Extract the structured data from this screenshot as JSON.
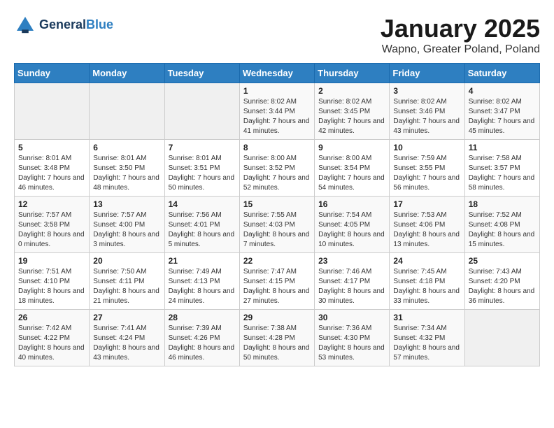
{
  "header": {
    "logo_line1": "General",
    "logo_line2": "Blue",
    "title": "January 2025",
    "subtitle": "Wapno, Greater Poland, Poland"
  },
  "days_of_week": [
    "Sunday",
    "Monday",
    "Tuesday",
    "Wednesday",
    "Thursday",
    "Friday",
    "Saturday"
  ],
  "weeks": [
    [
      {
        "day": "",
        "empty": true
      },
      {
        "day": "",
        "empty": true
      },
      {
        "day": "",
        "empty": true
      },
      {
        "day": "1",
        "sunrise": "8:02 AM",
        "sunset": "3:44 PM",
        "daylight": "7 hours and 41 minutes."
      },
      {
        "day": "2",
        "sunrise": "8:02 AM",
        "sunset": "3:45 PM",
        "daylight": "7 hours and 42 minutes."
      },
      {
        "day": "3",
        "sunrise": "8:02 AM",
        "sunset": "3:46 PM",
        "daylight": "7 hours and 43 minutes."
      },
      {
        "day": "4",
        "sunrise": "8:02 AM",
        "sunset": "3:47 PM",
        "daylight": "7 hours and 45 minutes."
      }
    ],
    [
      {
        "day": "5",
        "sunrise": "8:01 AM",
        "sunset": "3:48 PM",
        "daylight": "7 hours and 46 minutes."
      },
      {
        "day": "6",
        "sunrise": "8:01 AM",
        "sunset": "3:50 PM",
        "daylight": "7 hours and 48 minutes."
      },
      {
        "day": "7",
        "sunrise": "8:01 AM",
        "sunset": "3:51 PM",
        "daylight": "7 hours and 50 minutes."
      },
      {
        "day": "8",
        "sunrise": "8:00 AM",
        "sunset": "3:52 PM",
        "daylight": "7 hours and 52 minutes."
      },
      {
        "day": "9",
        "sunrise": "8:00 AM",
        "sunset": "3:54 PM",
        "daylight": "7 hours and 54 minutes."
      },
      {
        "day": "10",
        "sunrise": "7:59 AM",
        "sunset": "3:55 PM",
        "daylight": "7 hours and 56 minutes."
      },
      {
        "day": "11",
        "sunrise": "7:58 AM",
        "sunset": "3:57 PM",
        "daylight": "7 hours and 58 minutes."
      }
    ],
    [
      {
        "day": "12",
        "sunrise": "7:57 AM",
        "sunset": "3:58 PM",
        "daylight": "8 hours and 0 minutes."
      },
      {
        "day": "13",
        "sunrise": "7:57 AM",
        "sunset": "4:00 PM",
        "daylight": "8 hours and 3 minutes."
      },
      {
        "day": "14",
        "sunrise": "7:56 AM",
        "sunset": "4:01 PM",
        "daylight": "8 hours and 5 minutes."
      },
      {
        "day": "15",
        "sunrise": "7:55 AM",
        "sunset": "4:03 PM",
        "daylight": "8 hours and 7 minutes."
      },
      {
        "day": "16",
        "sunrise": "7:54 AM",
        "sunset": "4:05 PM",
        "daylight": "8 hours and 10 minutes."
      },
      {
        "day": "17",
        "sunrise": "7:53 AM",
        "sunset": "4:06 PM",
        "daylight": "8 hours and 13 minutes."
      },
      {
        "day": "18",
        "sunrise": "7:52 AM",
        "sunset": "4:08 PM",
        "daylight": "8 hours and 15 minutes."
      }
    ],
    [
      {
        "day": "19",
        "sunrise": "7:51 AM",
        "sunset": "4:10 PM",
        "daylight": "8 hours and 18 minutes."
      },
      {
        "day": "20",
        "sunrise": "7:50 AM",
        "sunset": "4:11 PM",
        "daylight": "8 hours and 21 minutes."
      },
      {
        "day": "21",
        "sunrise": "7:49 AM",
        "sunset": "4:13 PM",
        "daylight": "8 hours and 24 minutes."
      },
      {
        "day": "22",
        "sunrise": "7:47 AM",
        "sunset": "4:15 PM",
        "daylight": "8 hours and 27 minutes."
      },
      {
        "day": "23",
        "sunrise": "7:46 AM",
        "sunset": "4:17 PM",
        "daylight": "8 hours and 30 minutes."
      },
      {
        "day": "24",
        "sunrise": "7:45 AM",
        "sunset": "4:18 PM",
        "daylight": "8 hours and 33 minutes."
      },
      {
        "day": "25",
        "sunrise": "7:43 AM",
        "sunset": "4:20 PM",
        "daylight": "8 hours and 36 minutes."
      }
    ],
    [
      {
        "day": "26",
        "sunrise": "7:42 AM",
        "sunset": "4:22 PM",
        "daylight": "8 hours and 40 minutes."
      },
      {
        "day": "27",
        "sunrise": "7:41 AM",
        "sunset": "4:24 PM",
        "daylight": "8 hours and 43 minutes."
      },
      {
        "day": "28",
        "sunrise": "7:39 AM",
        "sunset": "4:26 PM",
        "daylight": "8 hours and 46 minutes."
      },
      {
        "day": "29",
        "sunrise": "7:38 AM",
        "sunset": "4:28 PM",
        "daylight": "8 hours and 50 minutes."
      },
      {
        "day": "30",
        "sunrise": "7:36 AM",
        "sunset": "4:30 PM",
        "daylight": "8 hours and 53 minutes."
      },
      {
        "day": "31",
        "sunrise": "7:34 AM",
        "sunset": "4:32 PM",
        "daylight": "8 hours and 57 minutes."
      },
      {
        "day": "",
        "empty": true
      }
    ]
  ]
}
